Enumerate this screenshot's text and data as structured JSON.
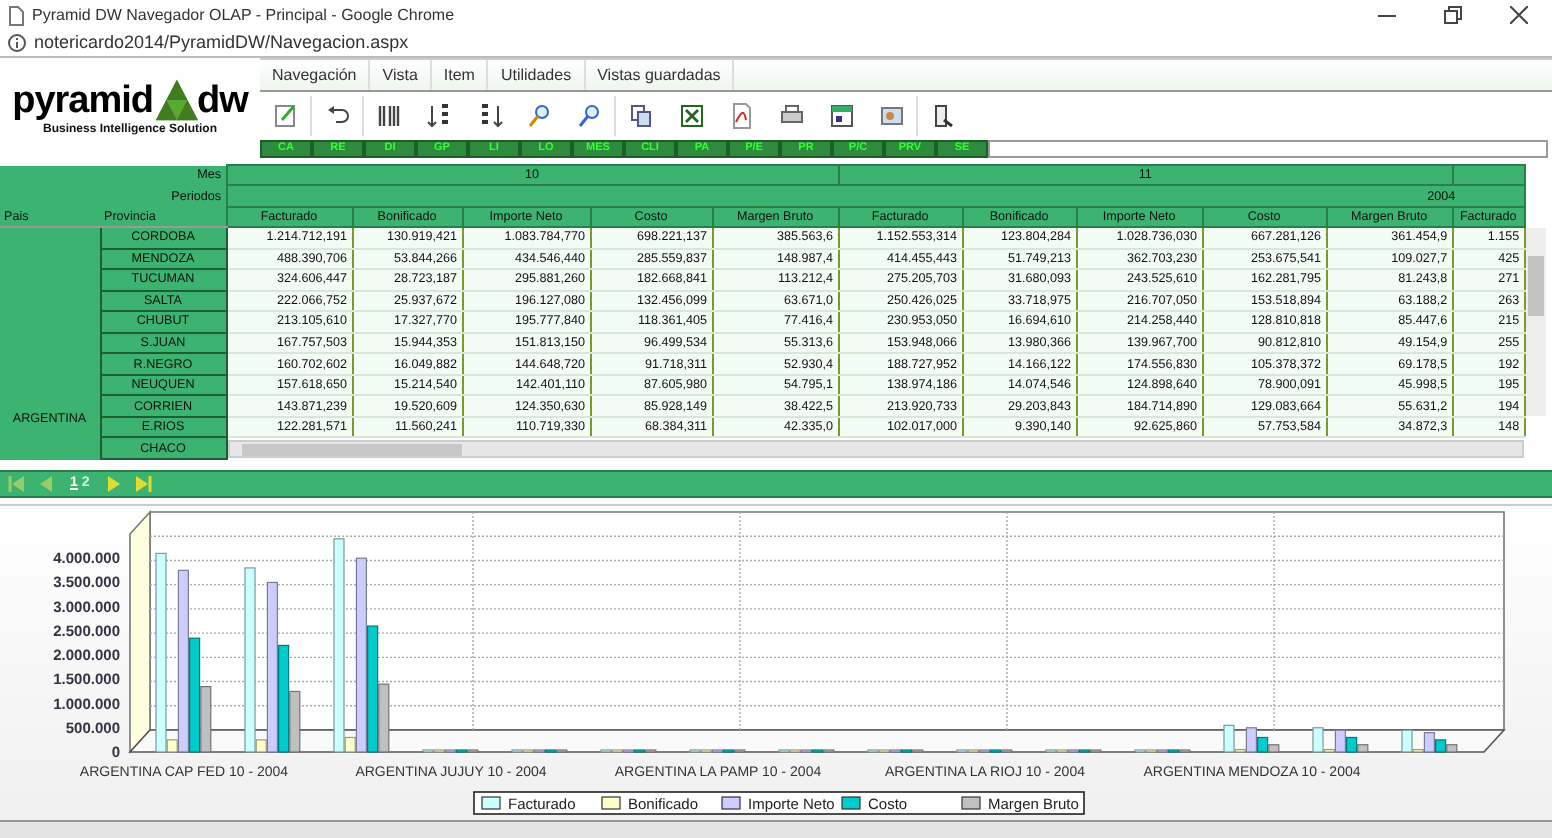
{
  "window": {
    "title": "Pyramid DW Navegador OLAP - Principal - Google Chrome"
  },
  "address_bar": {
    "url": "notericardo2014/PyramidDW/Navegacion.aspx"
  },
  "logo": {
    "name_left": "pyramid",
    "name_right": "dw",
    "tagline": "Business Intelligence Solution"
  },
  "menu": [
    "Navegación",
    "Vista",
    "Item",
    "Utilidades",
    "Vistas guardadas"
  ],
  "dimension_buttons": [
    "CA",
    "RE",
    "DI",
    "GP",
    "LI",
    "LO",
    "MES",
    "CLI",
    "PA",
    "P/E",
    "PR",
    "P/C",
    "PRV",
    "SE"
  ],
  "pivot": {
    "labels": {
      "mes": "Mes",
      "periodos": "Periodos",
      "pais": "Pais",
      "provincia": "Provincia"
    },
    "months": [
      "10",
      "11"
    ],
    "period": "2004",
    "measures": [
      "Facturado",
      "Bonificado",
      "Importe Neto",
      "Costo",
      "Margen Bruto",
      "Facturado",
      "Bonificado",
      "Importe Neto",
      "Costo",
      "Margen Bruto",
      "Facturado"
    ],
    "country": "ARGENTINA",
    "rows": [
      {
        "provincia": "CORDOBA",
        "values": [
          "1.214.712,191",
          "130.919,421",
          "1.083.784,770",
          "698.221,137",
          "385.563,6",
          "1.152.553,314",
          "123.804,284",
          "1.028.736,030",
          "667.281,126",
          "361.454,9",
          "1.155"
        ]
      },
      {
        "provincia": "MENDOZA",
        "values": [
          "488.390,706",
          "53.844,266",
          "434.546,440",
          "285.559,837",
          "148.987,4",
          "414.455,443",
          "51.749,213",
          "362.703,230",
          "253.675,541",
          "109.027,7",
          "425"
        ]
      },
      {
        "provincia": "TUCUMAN",
        "values": [
          "324.606,447",
          "28.723,187",
          "295.881,260",
          "182.668,841",
          "113.212,4",
          "275.205,703",
          "31.680,093",
          "243.525,610",
          "162.281,795",
          "81.243,8",
          "271"
        ]
      },
      {
        "provincia": "SALTA",
        "values": [
          "222.066,752",
          "25.937,672",
          "196.127,080",
          "132.456,099",
          "63.671,0",
          "250.426,025",
          "33.718,975",
          "216.707,050",
          "153.518,894",
          "63.188,2",
          "263"
        ]
      },
      {
        "provincia": "CHUBUT",
        "values": [
          "213.105,610",
          "17.327,770",
          "195.777,840",
          "118.361,405",
          "77.416,4",
          "230.953,050",
          "16.694,610",
          "214.258,440",
          "128.810,818",
          "85.447,6",
          "215"
        ]
      },
      {
        "provincia": "S.JUAN",
        "values": [
          "167.757,503",
          "15.944,353",
          "151.813,150",
          "96.499,534",
          "55.313,6",
          "153.948,066",
          "13.980,366",
          "139.967,700",
          "90.812,810",
          "49.154,9",
          "255"
        ]
      },
      {
        "provincia": "R.NEGRO",
        "values": [
          "160.702,602",
          "16.049,882",
          "144.648,720",
          "91.718,311",
          "52.930,4",
          "188.727,952",
          "14.166,122",
          "174.556,830",
          "105.378,372",
          "69.178,5",
          "192"
        ]
      },
      {
        "provincia": "NEUQUEN",
        "values": [
          "157.618,650",
          "15.214,540",
          "142.401,110",
          "87.605,980",
          "54.795,1",
          "138.974,186",
          "14.074,546",
          "124.898,640",
          "78.900,091",
          "45.998,5",
          "195"
        ]
      },
      {
        "provincia": "CORRIEN",
        "values": [
          "143.871,239",
          "19.520,609",
          "124.350,630",
          "85.928,149",
          "38.422,5",
          "213.920,733",
          "29.203,843",
          "184.714,890",
          "129.083,664",
          "55.631,2",
          "194"
        ]
      },
      {
        "provincia": "E.RIOS",
        "values": [
          "122.281,571",
          "11.560,241",
          "110.719,330",
          "68.384,311",
          "42.335,0",
          "102.017,000",
          "9.390,140",
          "92.625,860",
          "57.753,584",
          "34.872,3",
          "148"
        ]
      },
      {
        "provincia": "CHACO"
      }
    ]
  },
  "pager": {
    "pages": [
      {
        "label": "1",
        "selected": true
      },
      {
        "label": "2",
        "selected": false
      }
    ]
  },
  "chart": {
    "chart_data": {
      "type": "bar",
      "stacked": false,
      "grid": true,
      "legend": true,
      "categories": [
        "ARGENTINA CAP FED 10 - 2004",
        null,
        null,
        "ARGENTINA JUJUY 10 - 2004",
        null,
        null,
        "ARGENTINA LA PAMP 10 - 2004",
        null,
        null,
        "ARGENTINA LA RIOJ 10 - 2004",
        null,
        null,
        "ARGENTINA MENDOZA 10 - 2004",
        null,
        null
      ],
      "ylim": [
        0,
        4500000
      ],
      "yticks": [
        {
          "value": 0,
          "label": "0"
        },
        {
          "value": 500000,
          "label": "500.000"
        },
        {
          "value": 1000000,
          "label": "1.000.000"
        },
        {
          "value": 1500000,
          "label": "1.500.000"
        },
        {
          "value": 2000000,
          "label": "2.000.000"
        },
        {
          "value": 2500000,
          "label": "2.500.000"
        },
        {
          "value": 3000000,
          "label": "3.000.000"
        },
        {
          "value": 3500000,
          "label": "3.500.000"
        },
        {
          "value": 4000000,
          "label": "4.000.000"
        }
      ],
      "series": [
        {
          "name": "Facturado",
          "color": "#ccffff",
          "values": [
            4100000,
            3800000,
            4400000,
            0,
            0,
            0,
            0,
            0,
            0,
            0,
            0,
            0,
            550000,
            500000,
            450000
          ]
        },
        {
          "name": "Bonificado",
          "color": "#ffffcc",
          "values": [
            250000,
            250000,
            300000,
            0,
            0,
            0,
            0,
            0,
            0,
            0,
            0,
            0,
            50000,
            50000,
            50000
          ]
        },
        {
          "name": "Importe Neto",
          "color": "#ccccff",
          "values": [
            3750000,
            3500000,
            4000000,
            0,
            0,
            0,
            0,
            0,
            0,
            0,
            0,
            0,
            500000,
            450000,
            400000
          ]
        },
        {
          "name": "Costo",
          "color": "#00cccc",
          "values": [
            2350000,
            2200000,
            2600000,
            0,
            0,
            0,
            0,
            0,
            0,
            0,
            0,
            0,
            300000,
            300000,
            250000
          ]
        },
        {
          "name": "Margen Bruto",
          "color": "#c0c0c0",
          "values": [
            1350000,
            1250000,
            1400000,
            0,
            0,
            0,
            0,
            0,
            0,
            0,
            0,
            0,
            150000,
            150000,
            150000
          ]
        }
      ]
    }
  }
}
